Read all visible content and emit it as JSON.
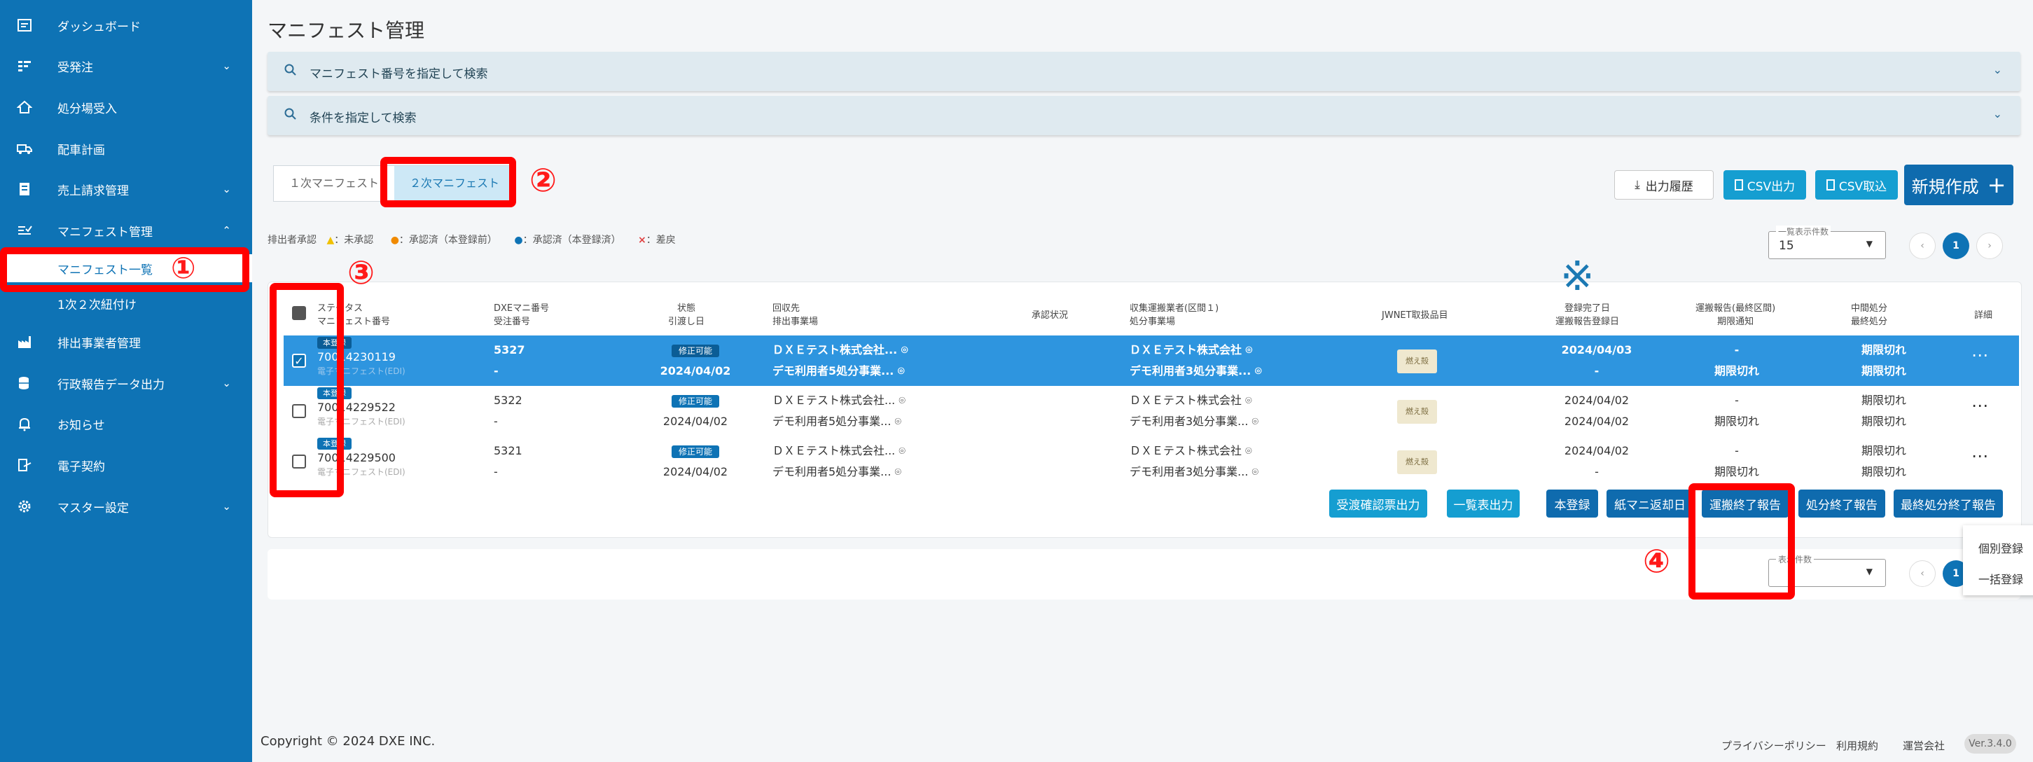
{
  "sidebar": {
    "items": [
      {
        "label": "ダッシュボード",
        "icon": "dashboard-icon",
        "chev": ""
      },
      {
        "label": "受発注",
        "icon": "order-icon",
        "chev": "⌄"
      },
      {
        "label": "処分場受入",
        "icon": "home-icon",
        "chev": ""
      },
      {
        "label": "配車計画",
        "icon": "truck-icon",
        "chev": ""
      },
      {
        "label": "売上請求管理",
        "icon": "invoice-icon",
        "chev": "⌄"
      },
      {
        "label": "マニフェスト管理",
        "icon": "manifest-icon",
        "chev": "⌃"
      },
      {
        "label": "排出事業者管理",
        "icon": "factory-icon",
        "chev": ""
      },
      {
        "label": "行政報告データ出力",
        "icon": "database-icon",
        "chev": "⌄"
      },
      {
        "label": "お知らせ",
        "icon": "bell-icon",
        "chev": ""
      },
      {
        "label": "電子契約",
        "icon": "contract-icon",
        "chev": ""
      },
      {
        "label": "マスター設定",
        "icon": "gear-icon",
        "chev": "⌄"
      }
    ],
    "sub_items": [
      {
        "label": "マニフェスト一覧"
      },
      {
        "label": "1次２次紐付け"
      }
    ]
  },
  "page": {
    "title": "マニフェスト管理",
    "search_by_number": "マニフェスト番号を指定して検索",
    "search_by_condition": "条件を指定して検索"
  },
  "tabs": {
    "primary": "１次マニフェスト",
    "secondary": "２次マニフェスト"
  },
  "toolbar": {
    "output_history": "出力履歴",
    "csv_export": "CSV出力",
    "csv_import": "CSV取込",
    "new_create": "新規作成"
  },
  "legend": {
    "prefix": "排出者承認",
    "unapproved": "：未承認",
    "approved_unregistered": "：承認済（本登録前）",
    "approved_registered": "：承認済（本登録済）",
    "rejected": "：差戻"
  },
  "page_size": {
    "caption": "一覧表示件数",
    "value": "15",
    "caption_bottom": "表示件数"
  },
  "pagination": {
    "current": "1"
  },
  "table": {
    "headers": {
      "status": "ステータス",
      "manifest_no": "マニフェスト番号",
      "dxe_no": "DXEマニ番号",
      "order_no": "受注番号",
      "state": "状態",
      "delivery_date": "引渡し日",
      "collection_site": "回収先",
      "emission_site": "排出事業場",
      "approval": "承認状況",
      "collector": "収集運搬業者(区間１)",
      "disposer": "処分事業場",
      "jwnet": "JWNET取扱品目",
      "reg_done": "登録完了日",
      "transport_report_date": "運搬報告登録日",
      "transport_report": "運搬報告(最終区間)",
      "deadline_notice": "期限通知",
      "mid_disposal": "中間処分",
      "final_disposal": "最終処分",
      "detail": "詳細"
    },
    "rows": [
      {
        "status": "本登録",
        "manifest_no": "70014230119",
        "edi": "電子マニフェスト(EDI)",
        "dxe_no": "5327",
        "order_no": "-",
        "state": "修正可能",
        "date": "2024/04/02",
        "collection": "ＤＸＥテスト株式会社...",
        "emission": "デモ利用者5処分事業...",
        "collector": "ＤＸＥテスト株式会社",
        "disposer": "デモ利用者3処分事業...",
        "jwnet": "燃え殻",
        "reg_done": "2024/04/03",
        "transport_date": "-",
        "transport_report": "-",
        "deadline": "期限切れ",
        "mid": "期限切れ",
        "final": "期限切れ",
        "checked": true
      },
      {
        "status": "本登録",
        "manifest_no": "70014229522",
        "edi": "電子マニフェスト(EDI)",
        "dxe_no": "5322",
        "order_no": "-",
        "state": "修正可能",
        "date": "2024/04/02",
        "collection": "ＤＸＥテスト株式会社...",
        "emission": "デモ利用者5処分事業...",
        "collector": "ＤＸＥテスト株式会社",
        "disposer": "デモ利用者3処分事業...",
        "jwnet": "燃え殻",
        "reg_done": "2024/04/02",
        "transport_date": "2024/04/02",
        "transport_report": "-",
        "deadline": "期限切れ",
        "mid": "期限切れ",
        "final": "期限切れ",
        "checked": false
      },
      {
        "status": "本登録",
        "manifest_no": "70014229500",
        "edi": "電子マニフェスト(EDI)",
        "dxe_no": "5321",
        "order_no": "-",
        "state": "修正可能",
        "date": "2024/04/02",
        "collection": "ＤＸＥテスト株式会社...",
        "emission": "デモ利用者5処分事業...",
        "collector": "ＤＸＥテスト株式会社",
        "disposer": "デモ利用者3処分事業...",
        "jwnet": "燃え殻",
        "reg_done": "2024/04/02",
        "transport_date": "-",
        "transport_report": "-",
        "deadline": "期限切れ",
        "mid": "期限切れ",
        "final": "期限切れ",
        "checked": false
      }
    ]
  },
  "actions": {
    "receipt_confirm": "受渡確認票出力",
    "list_output": "一覧表出力",
    "main_register": "本登録",
    "paper_return": "紙マニ返却日",
    "transport_end": "運搬終了報告",
    "disposal_end": "処分終了報告",
    "final_disposal_end": "最終処分終了報告"
  },
  "dropdown": {
    "individual": "個別登録",
    "bulk": "一括登録"
  },
  "annotations": {
    "n1": "①",
    "n2": "②",
    "n3": "③",
    "n4": "④",
    "mark": "※"
  },
  "footer": {
    "copyright": "Copyright © 2024 DXE INC.",
    "privacy": "プライバシーポリシー",
    "terms": "利用規約",
    "company": "運営会社",
    "version": "Ver.3.4.0"
  },
  "colors": {
    "sidebar": "#0e73b5",
    "annotation": "#ff0000",
    "teal": "#159ed1",
    "selected_row": "#2e95df"
  }
}
